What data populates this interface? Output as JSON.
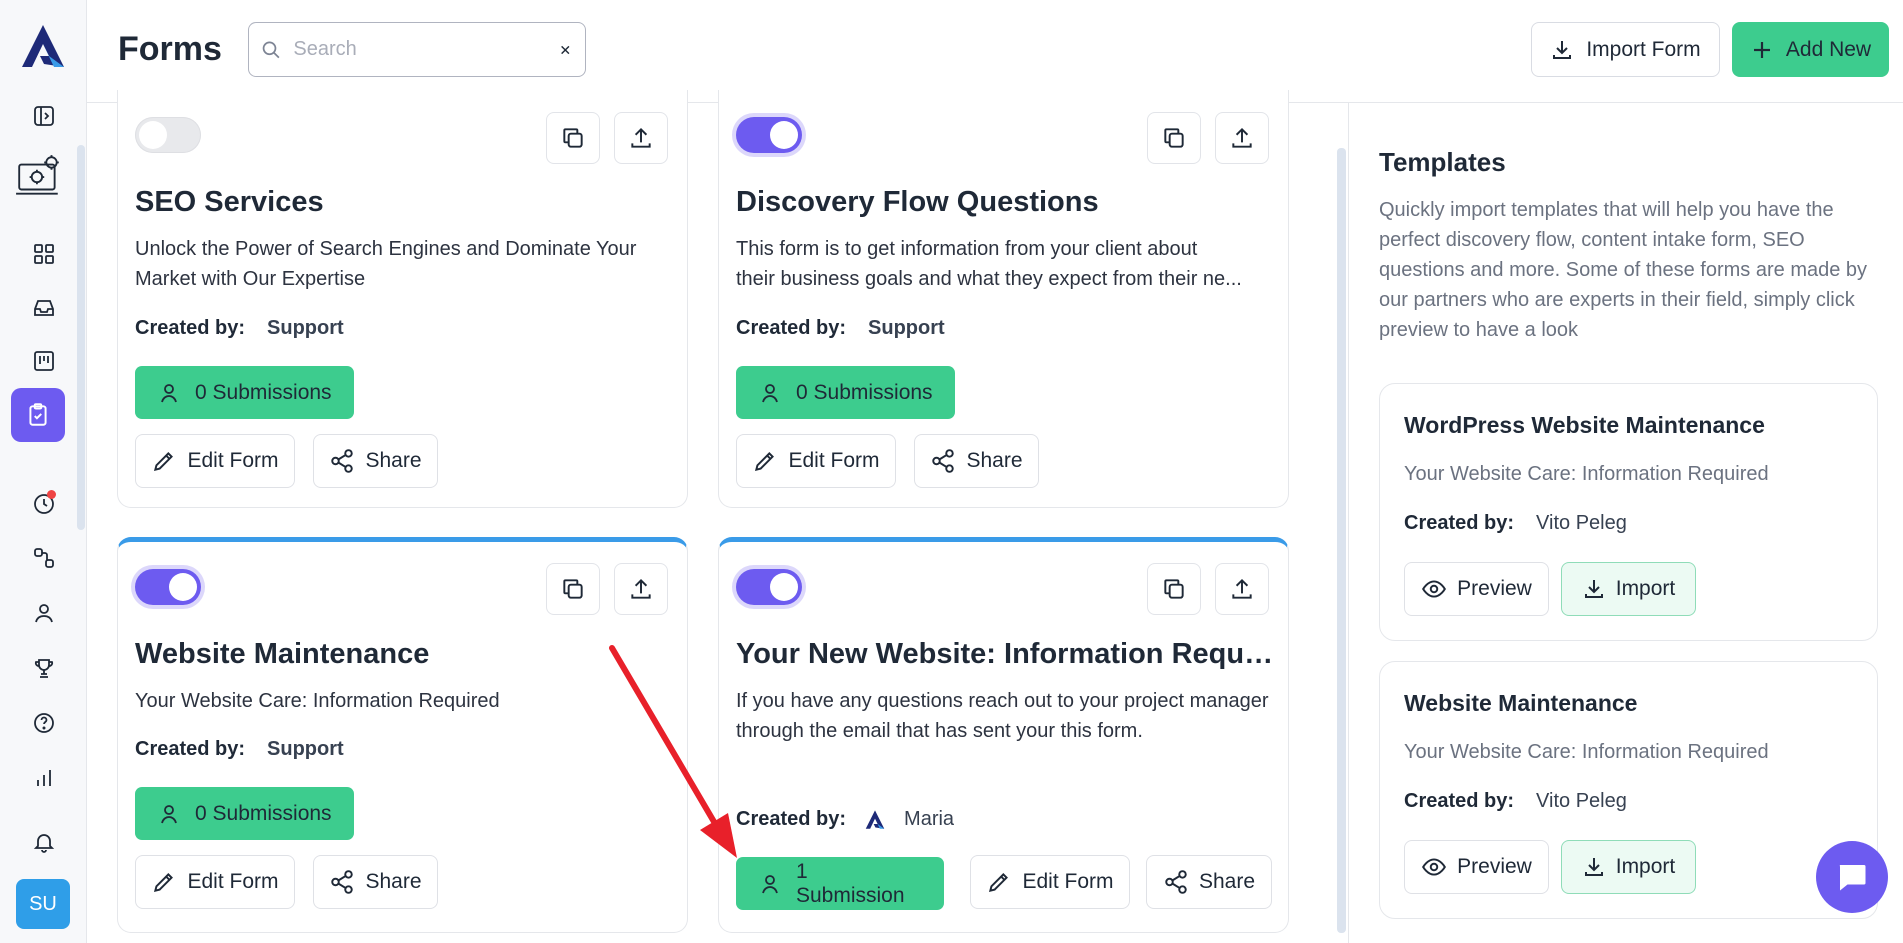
{
  "app": {
    "page_title": "Forms",
    "avatar_initials": "SU"
  },
  "search": {
    "placeholder": "Search",
    "value": ""
  },
  "header": {
    "import_label": "Import Form",
    "add_label": "Add New"
  },
  "forms": [
    {
      "title": "SEO Services",
      "description": "Unlock the Power of Search Engines and Dominate Your Market with Our Expertise",
      "created_label": "Created by:",
      "creator": "Support",
      "submissions": "0 Submissions",
      "enabled": false,
      "edit_label": "Edit Form",
      "share_label": "Share"
    },
    {
      "title": "Discovery Flow Questions",
      "description_line1": "This form is to get information from your client about",
      "description_line2": "their business goals and what they expect from their ne...",
      "created_label": "Created by:",
      "creator": "Support",
      "submissions": "0 Submissions",
      "enabled": true,
      "edit_label": "Edit Form",
      "share_label": "Share"
    },
    {
      "title": "Website Maintenance",
      "description": "Your Website Care: Information Required",
      "created_label": "Created by:",
      "creator": "Support",
      "submissions": "0 Submissions",
      "enabled": true,
      "edit_label": "Edit Form",
      "share_label": "Share"
    },
    {
      "title": "Your New Website: Information Requi...",
      "description": "If you have any questions reach out to your project manager through the email that has sent your this form.",
      "created_label": "Created by:",
      "creator": "Maria",
      "submissions": "1 Submission",
      "enabled": true,
      "edit_label": "Edit Form",
      "share_label": "Share"
    }
  ],
  "templates": {
    "title": "Templates",
    "description": "Quickly import templates that will help you have the perfect discovery flow, content intake form, SEO questions and more. Some of these forms are made by our partners who are experts in their field, simply click preview to have a look",
    "items": [
      {
        "name": "WordPress Website Maintenance",
        "description": "Your Website Care: Information Required",
        "created_label": "Created by:",
        "creator": "Vito Peleg",
        "preview_label": "Preview",
        "import_label": "Import"
      },
      {
        "name": "Website Maintenance",
        "description": "Your Website Care: Information Required",
        "created_label": "Created by:",
        "creator": "Vito Peleg",
        "preview_label": "Preview",
        "import_label": "Import"
      }
    ]
  },
  "colors": {
    "primary": "#6d5bf0",
    "success": "#3dcc8e",
    "accent_border": "#3a9be8",
    "annotation_arrow": "#e8202a"
  }
}
